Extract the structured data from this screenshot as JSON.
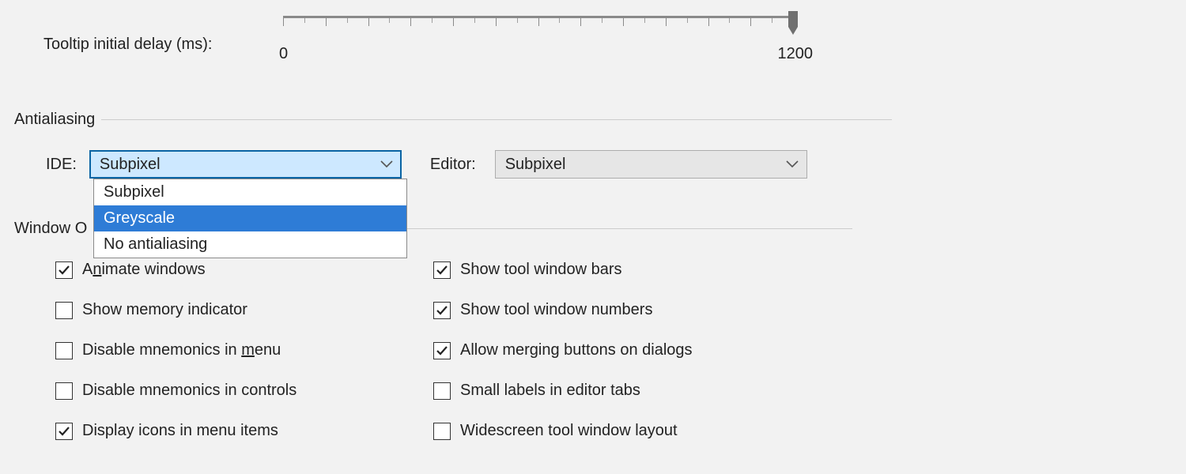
{
  "tooltip_delay": {
    "label": "Tooltip initial delay (ms):",
    "min_label": "0",
    "max_label": "1200",
    "min": 0,
    "max": 1200,
    "value": 1200
  },
  "antialias": {
    "group_title": "Antialiasing",
    "ide_label": "IDE:",
    "ide_value": "Subpixel",
    "ide_options": [
      "Subpixel",
      "Greyscale",
      "No antialiasing"
    ],
    "ide_highlighted": "Greyscale",
    "editor_label": "Editor:",
    "editor_value": "Subpixel"
  },
  "window_options": {
    "group_title": "Window O",
    "left": [
      {
        "label_pre": "A",
        "label_u": "n",
        "label_post": "imate windows",
        "checked": true
      },
      {
        "label_pre": "Show memory indicator",
        "label_u": "",
        "label_post": "",
        "checked": false
      },
      {
        "label_pre": "Disable mnemonics in ",
        "label_u": "m",
        "label_post": "enu",
        "checked": false
      },
      {
        "label_pre": "Disable mnemonics in controls",
        "label_u": "",
        "label_post": "",
        "checked": false
      },
      {
        "label_pre": "Display icons in menu items",
        "label_u": "",
        "label_post": "",
        "checked": true
      }
    ],
    "right": [
      {
        "label_pre": "Show tool window bars",
        "checked": true
      },
      {
        "label_pre": "Show tool window numbers",
        "checked": true
      },
      {
        "label_pre": "Allow merging buttons on dialogs",
        "checked": true
      },
      {
        "label_pre": "Small labels in editor tabs",
        "checked": false
      },
      {
        "label_pre": "Widescreen tool window layout",
        "checked": false
      }
    ]
  }
}
